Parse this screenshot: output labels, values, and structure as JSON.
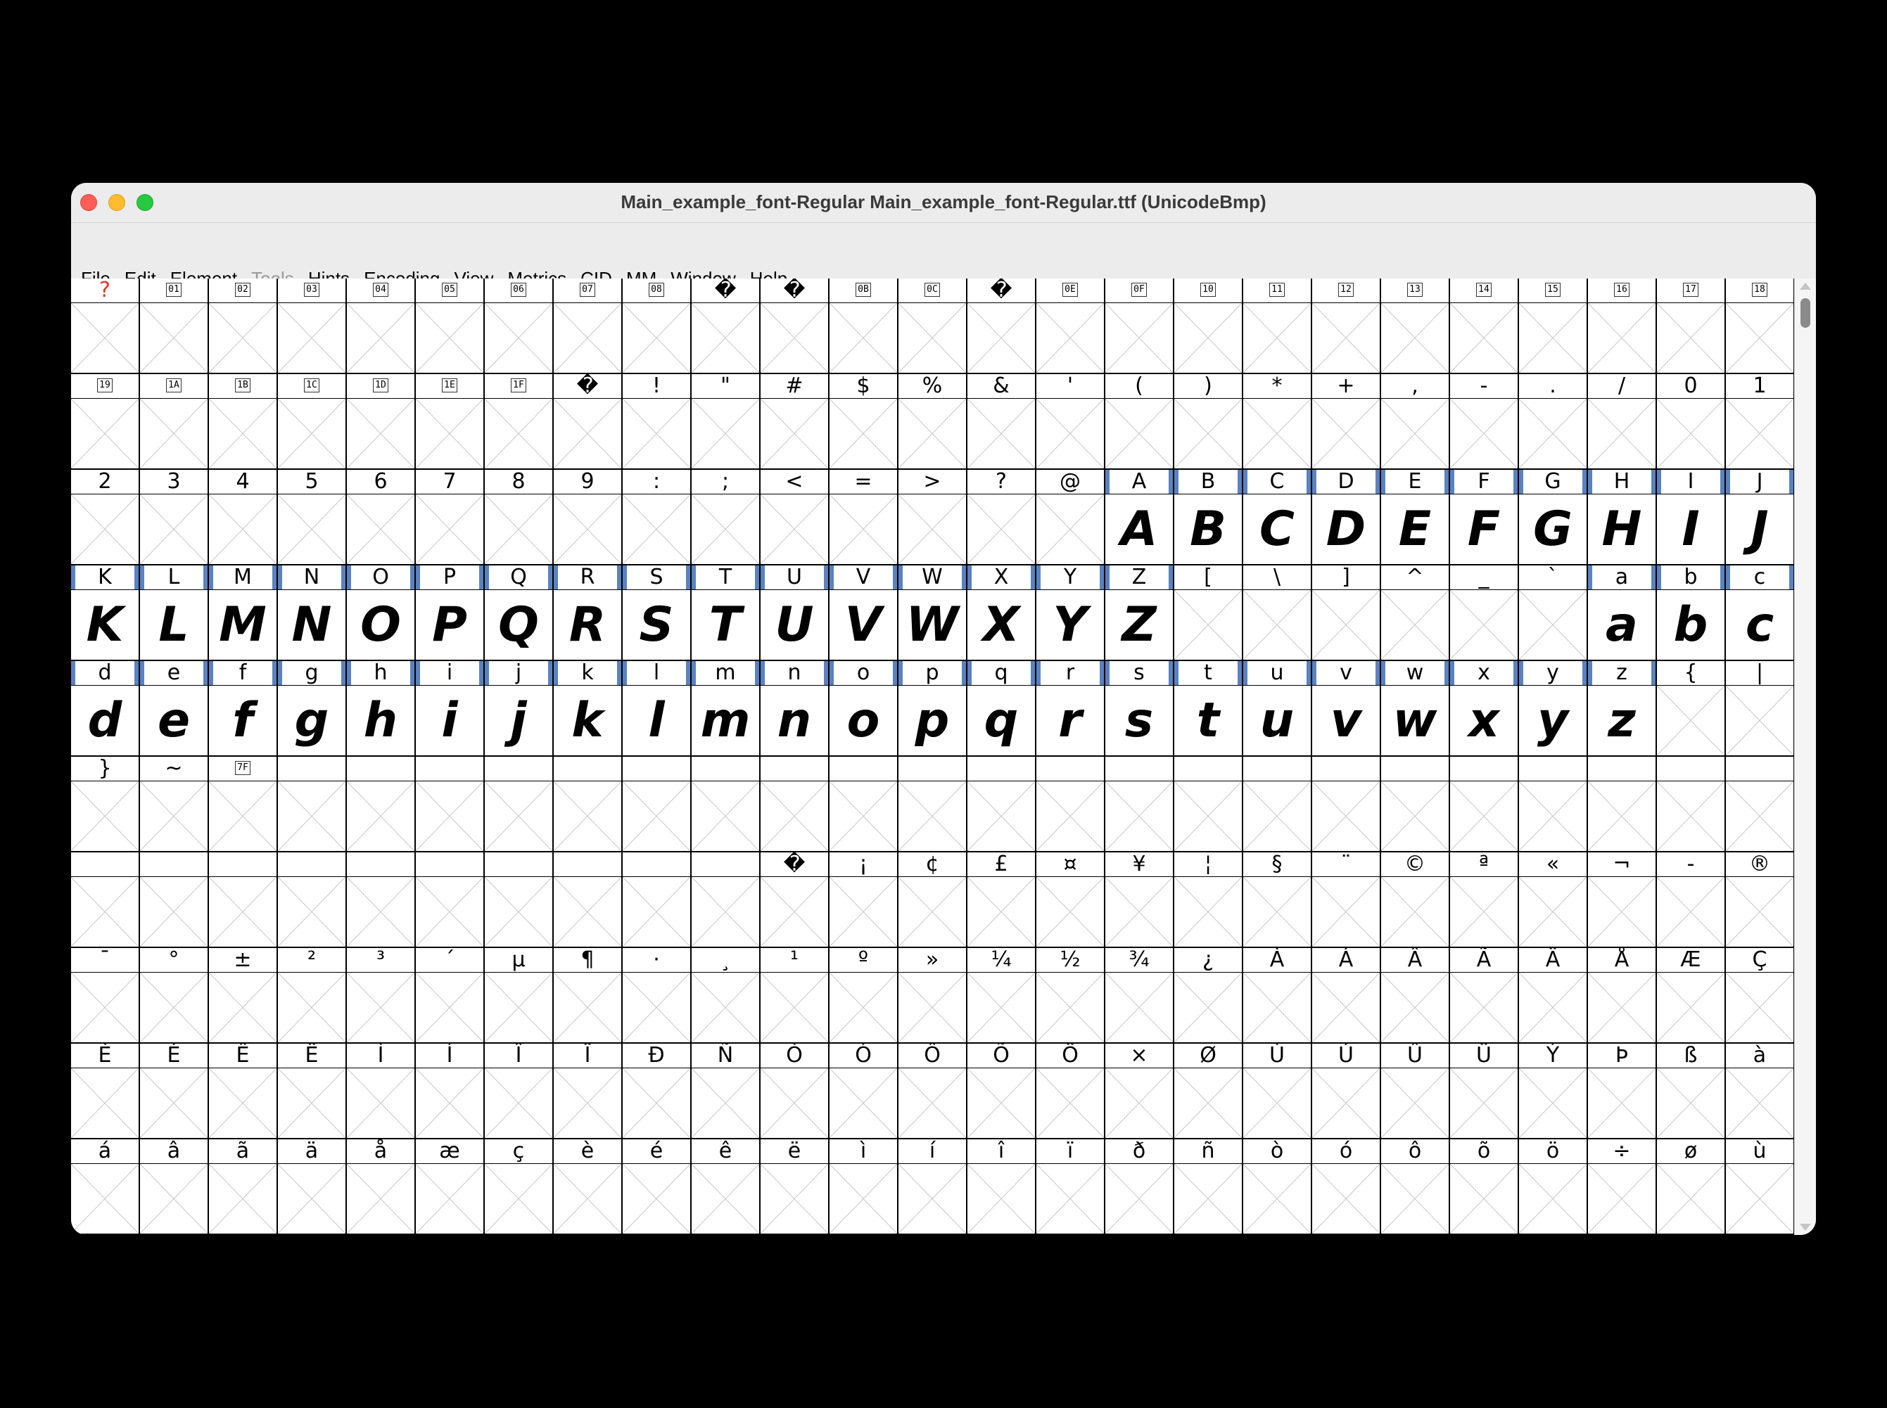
{
  "window": {
    "title": "Main_example_font-Regular  Main_example_font-Regular.ttf (UnicodeBmp)"
  },
  "menu": [
    {
      "label": "File",
      "disabled": false
    },
    {
      "label": "Edit",
      "disabled": false
    },
    {
      "label": "Element",
      "disabled": false
    },
    {
      "label": "Tools",
      "disabled": true
    },
    {
      "label": "Hints",
      "disabled": false
    },
    {
      "label": "Encoding",
      "disabled": false
    },
    {
      "label": "View",
      "disabled": false
    },
    {
      "label": "Metrics",
      "disabled": false
    },
    {
      "label": "CID",
      "disabled": false
    },
    {
      "label": "MM",
      "disabled": false
    },
    {
      "label": "Window",
      "disabled": false
    },
    {
      "label": "Help",
      "disabled": false
    }
  ],
  "grid": {
    "columns": 25,
    "rows": [
      [
        "?",
        "[01]",
        "[02]",
        "[03]",
        "[04]",
        "[05]",
        "[06]",
        "[07]",
        "[08]",
        "�",
        "�",
        "[0B]",
        "[0C]",
        "�",
        "[0E]",
        "[0F]",
        "[10]",
        "[11]",
        "[12]",
        "[13]",
        "[14]",
        "[15]",
        "[16]",
        "[17]",
        "[18]"
      ],
      [
        "[19]",
        "[1A]",
        "[1B]",
        "[1C]",
        "[1D]",
        "[1E]",
        "[1F]",
        "�",
        "!",
        "\"",
        "#",
        "$",
        "%",
        "&",
        "'",
        "(",
        ")",
        "*",
        "+",
        ",",
        "-",
        ".",
        "/",
        "0",
        "1"
      ],
      [
        "2",
        "3",
        "4",
        "5",
        "6",
        "7",
        "8",
        "9",
        ":",
        ";",
        "<",
        "=",
        ">",
        "?",
        "@",
        "A",
        "B",
        "C",
        "D",
        "E",
        "F",
        "G",
        "H",
        "I",
        "J"
      ],
      [
        "K",
        "L",
        "M",
        "N",
        "O",
        "P",
        "Q",
        "R",
        "S",
        "T",
        "U",
        "V",
        "W",
        "X",
        "Y",
        "Z",
        "[",
        "\\",
        "]",
        "^",
        "_",
        "`",
        "a",
        "b",
        "c"
      ],
      [
        "d",
        "e",
        "f",
        "g",
        "h",
        "i",
        "j",
        "k",
        "l",
        "m",
        "n",
        "o",
        "p",
        "q",
        "r",
        "s",
        "t",
        "u",
        "v",
        "w",
        "x",
        "y",
        "z",
        "{",
        "|"
      ],
      [
        "}",
        "~",
        "[7F]",
        "",
        "",
        "",
        "",
        "",
        "",
        "",
        "",
        "",
        "",
        "",
        "",
        "",
        "",
        "",
        "",
        "",
        "",
        "",
        "",
        "",
        ""
      ],
      [
        "",
        "",
        "",
        "",
        "",
        "",
        "",
        "",
        "",
        "",
        "�",
        "¡",
        "¢",
        "£",
        "¤",
        "¥",
        "¦",
        "§",
        "¨",
        "©",
        "ª",
        "«",
        "¬",
        "-",
        "®"
      ],
      [
        "¯",
        "°",
        "±",
        "²",
        "³",
        "´",
        "µ",
        "¶",
        "·",
        "¸",
        "¹",
        "º",
        "»",
        "¼",
        "½",
        "¾",
        "¿",
        "À",
        "Á",
        "Â",
        "Ã",
        "Ä",
        "Å",
        "Æ",
        "Ç"
      ],
      [
        "È",
        "É",
        "Ê",
        "Ë",
        "Ì",
        "Í",
        "Î",
        "Ï",
        "Ð",
        "Ñ",
        "Ò",
        "Ó",
        "Ô",
        "Õ",
        "Ö",
        "×",
        "Ø",
        "Ù",
        "Ú",
        "Û",
        "Ü",
        "Ý",
        "Þ",
        "ß",
        "à"
      ],
      [
        "á",
        "â",
        "ã",
        "ä",
        "å",
        "æ",
        "ç",
        "è",
        "é",
        "ê",
        "ë",
        "ì",
        "í",
        "î",
        "ï",
        "ð",
        "ñ",
        "ò",
        "ó",
        "ô",
        "õ",
        "ö",
        "÷",
        "ø",
        "ù"
      ]
    ],
    "drawn_glyphs": "ABCDEFGHIJKLMNOPQRSTUVWXYZabcdefghijklmnopqrstuvwxyz"
  }
}
